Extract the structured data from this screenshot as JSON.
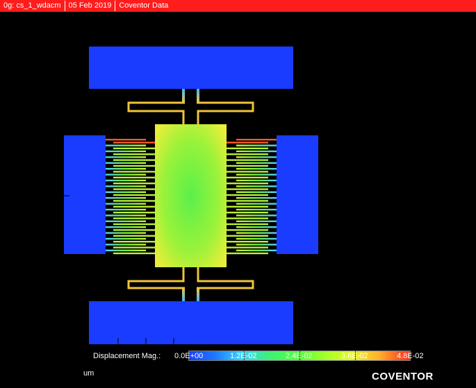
{
  "window": {
    "tabs": [
      "0g: cs_1_wdacm",
      "05 Feb 2019",
      "Coventor Data"
    ]
  },
  "legend": {
    "label": "Displacement Mag.:",
    "ticks": [
      "0.0E+00",
      "1.2E-02",
      "2.4E-02",
      "3.6E-02",
      "4.8E-02"
    ],
    "units": "um"
  },
  "brand": "COVENTOR",
  "colors": {
    "title_bar": "#ff1c1c",
    "anchor_blue": "#1a3cff",
    "proof_mass": "#8ef03a",
    "background": "#000000"
  }
}
